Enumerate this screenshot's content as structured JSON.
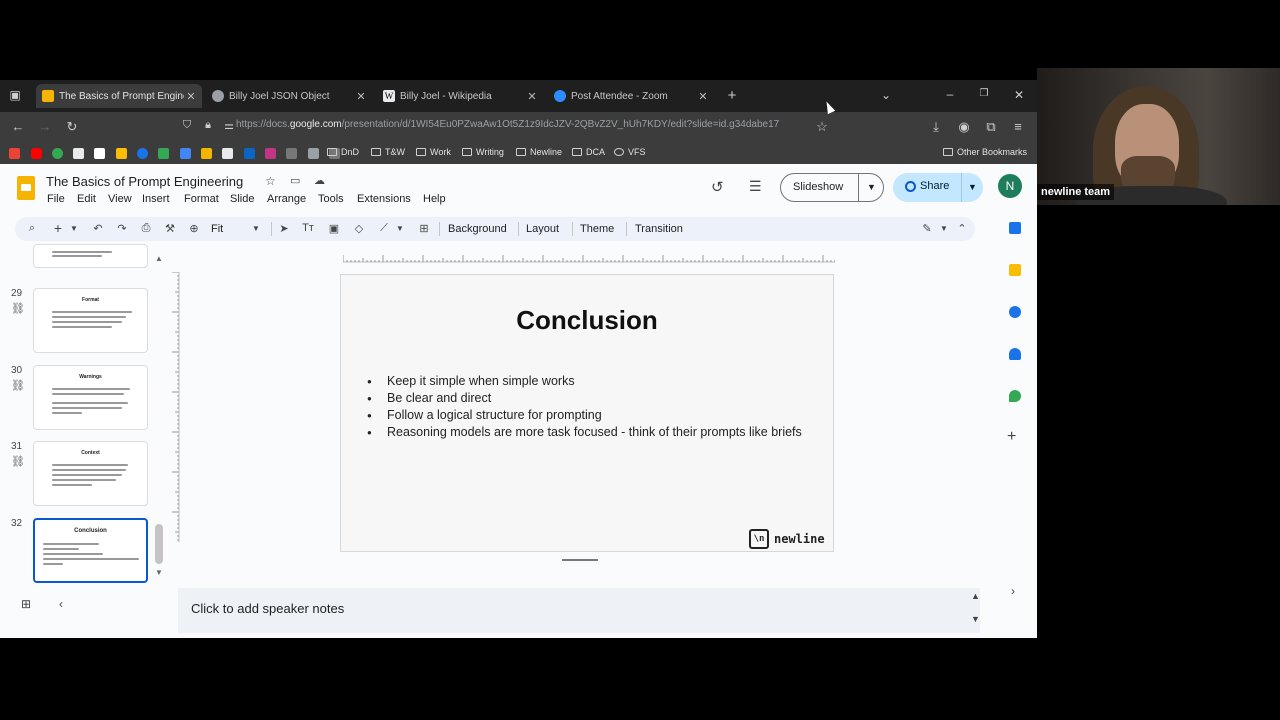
{
  "browser": {
    "tabs": [
      {
        "title": "The Basics of Prompt Engineeri",
        "active": true,
        "favicon_color": "#f4b400"
      },
      {
        "title": "Billy Joel JSON Object",
        "active": false,
        "favicon_color": "#9aa0a6"
      },
      {
        "title": "Billy Joel - Wikipedia",
        "active": false,
        "favicon_color": "#e8eaed"
      },
      {
        "title": "Post Attendee - Zoom",
        "active": false,
        "favicon_color": "#2d8cff"
      }
    ],
    "url_prefix": "https://docs.",
    "url_host": "google.com",
    "url_path": "/presentation/d/1WI54Eu0PZwaAw1Ot5Z1z9IdcJZV-2QBvZ2V_hUh7KDY/edit?slide=id.g34dabe17",
    "bookmarks": [
      "DnD",
      "T&W",
      "Work",
      "Writing",
      "Newline",
      "DCA",
      "VFS"
    ],
    "other_bookmarks": "Other Bookmarks"
  },
  "doc": {
    "title": "The Basics of Prompt Engineering",
    "menus": [
      "File",
      "Edit",
      "View",
      "Insert",
      "Format",
      "Slide",
      "Arrange",
      "Tools",
      "Extensions",
      "Help"
    ],
    "slideshow_label": "Slideshow",
    "share_label": "Share",
    "avatar_initial": "N"
  },
  "toolbar": {
    "zoom": "Fit",
    "background": "Background",
    "layout": "Layout",
    "theme": "Theme",
    "transition": "Transition"
  },
  "filmstrip": {
    "slides": [
      {
        "number": "29",
        "title": "Format"
      },
      {
        "number": "30",
        "title": "Warnings"
      },
      {
        "number": "31",
        "title": "Context"
      },
      {
        "number": "32",
        "title": "Conclusion",
        "selected": true
      }
    ]
  },
  "slide": {
    "title": "Conclusion",
    "bullets": [
      "Keep it simple when simple works",
      "Be clear and direct",
      "Follow a logical structure for prompting",
      "Reasoning models are more task focused - think of their prompts like briefs"
    ],
    "logo_mark": "\\n",
    "logo_word": "newline"
  },
  "notes": {
    "placeholder": "Click to add speaker notes"
  },
  "webcam": {
    "name": "newline team"
  },
  "colors": {
    "accent": "#0b57d0",
    "share_bg": "#c2e7ff",
    "avatar": "#1e7d5a"
  }
}
